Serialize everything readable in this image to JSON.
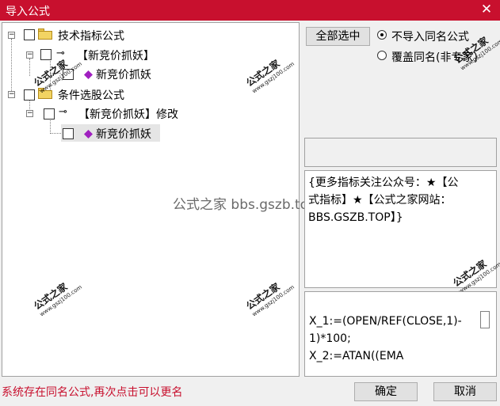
{
  "window": {
    "title": "导入公式",
    "close_glyph": "✕"
  },
  "tree": {
    "nodes": [
      {
        "label": "技术指标公式"
      },
      {
        "label": "【新竞价抓妖】"
      },
      {
        "label": "新竞价抓妖"
      },
      {
        "label": "条件选股公式"
      },
      {
        "label": "【新竞价抓妖】修改"
      },
      {
        "label": "新竞价抓妖"
      }
    ]
  },
  "watermarks": {
    "corner_big": "公式之家",
    "corner_small": "www.gszj100.com",
    "center": "公式之家 bbs.gszb.top"
  },
  "options": {
    "select_all_label": "全部选中",
    "radio_no_import": "不导入同名公式",
    "radio_overwrite": "覆盖同名(非专家)",
    "selected_radio": "no_import"
  },
  "description": {
    "lines": [
      "{更多指标关注公众号：★【公",
      "式指标】★【公式之家网站：",
      "BBS.GSZB.TOP】}"
    ]
  },
  "code": {
    "lines": [
      "X_1:=(OPEN/REF(CLOSE,1)-",
      "1)*100;",
      "X_2:=ATAN((EMA"
    ]
  },
  "footer": {
    "status": "系统存在同名公式,再次点击可以更名",
    "ok_label": "确定",
    "cancel_label": "取消"
  },
  "colors": {
    "titlebar": "#c8102e",
    "status_text": "#c8102e",
    "gem": "#a020c0"
  }
}
